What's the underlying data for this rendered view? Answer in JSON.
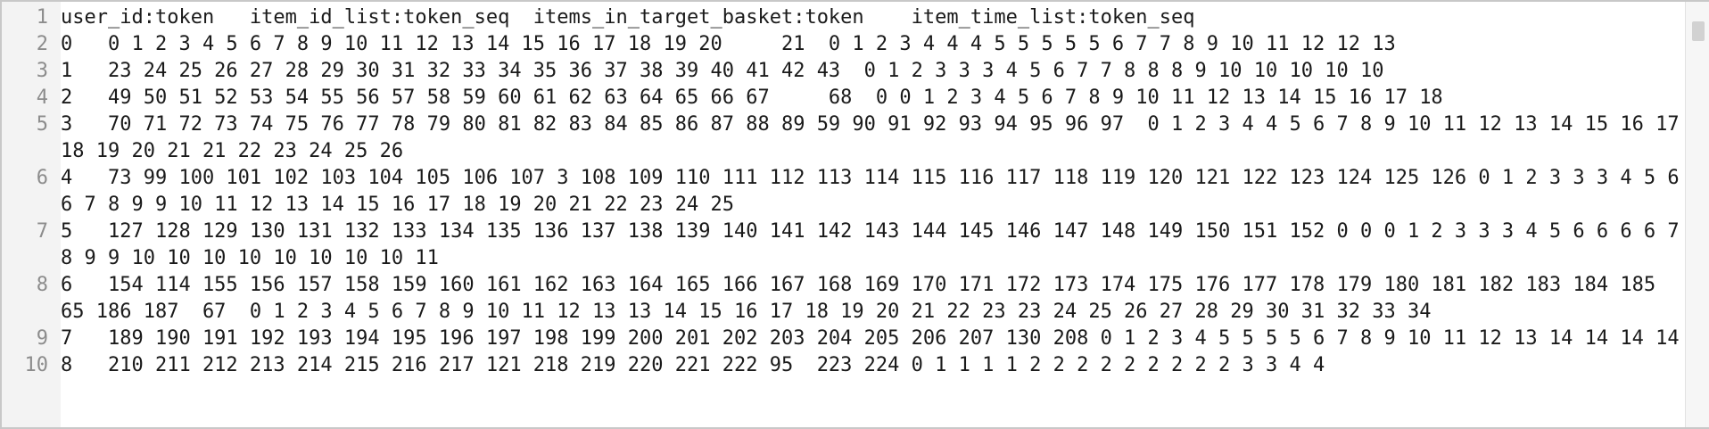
{
  "editor": {
    "lines": [
      {
        "number": "1",
        "text": "user_id:token   item_id_list:token_seq  items_in_target_basket:token    item_time_list:token_seq"
      },
      {
        "number": "2",
        "text": "0   0 1 2 3 4 5 6 7 8 9 10 11 12 13 14 15 16 17 18 19 20     21  0 1 2 3 4 4 4 5 5 5 5 5 6 7 7 8 9 10 11 12 12 13"
      },
      {
        "number": "3",
        "text": "1   23 24 25 26 27 28 29 30 31 32 33 34 35 36 37 38 39 40 41 42 43  0 1 2 3 3 3 4 5 6 7 7 8 8 8 9 10 10 10 10 10"
      },
      {
        "number": "4",
        "text": "2   49 50 51 52 53 54 55 56 57 58 59 60 61 62 63 64 65 66 67     68  0 0 1 2 3 4 5 6 7 8 9 10 11 12 13 14 15 16 17 18"
      },
      {
        "number": "5",
        "text": "3   70 71 72 73 74 75 76 77 78 79 80 81 82 83 84 85 86 87 88 89 59 90 91 92 93 94 95 96 97  0 1 2 3 4 4 5 6 7 8 9 10 11 12 13 14 15 16 17 18 19 20 21 21 22 23 24 25 26"
      },
      {
        "number": "6",
        "text": "4   73 99 100 101 102 103 104 105 106 107 3 108 109 110 111 112 113 114 115 116 117 118 119 120 121 122 123 124 125 126 0 1 2 3 3 3 4 5 6 6 7 8 9 9 10 11 12 13 14 15 16 17 18 19 20 21 22 23 24 25"
      },
      {
        "number": "7",
        "text": "5   127 128 129 130 131 132 133 134 135 136 137 138 139 140 141 142 143 144 145 146 147 148 149 150 151 152 0 0 0 1 2 3 3 3 4 5 6 6 6 6 7 8 9 9 10 10 10 10 10 10 10 10 11"
      },
      {
        "number": "8",
        "text": "6   154 114 155 156 157 158 159 160 161 162 163 164 165 166 167 168 169 170 171 172 173 174 175 176 177 178 179 180 181 182 183 184 185 65 186 187  67  0 1 2 3 4 5 6 7 8 9 10 11 12 13 13 14 15 16 17 18 19 20 21 22 23 23 24 25 26 27 28 29 30 31 32 33 34"
      },
      {
        "number": "9",
        "text": "7   189 190 191 192 193 194 195 196 197 198 199 200 201 202 203 204 205 206 207 130 208 0 1 2 3 4 5 5 5 5 6 7 8 9 10 11 12 13 14 14 14 14"
      },
      {
        "number": "10",
        "text": "8   210 211 212 213 214 215 216 217 121 218 219 220 221 222 95  223 224 0 1 1 1 1 2 2 2 2 2 2 2 2 2 3 3 4 4"
      }
    ]
  }
}
